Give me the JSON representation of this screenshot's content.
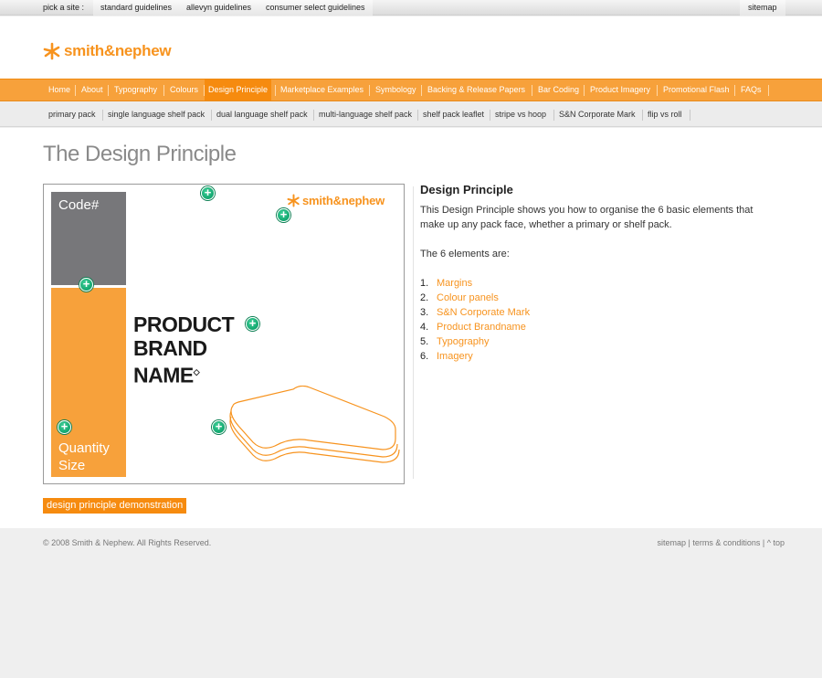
{
  "sitebar": {
    "pick_label": "pick a site :",
    "sites": [
      "standard guidelines",
      "allevyn guidelines",
      "consumer select guidelines"
    ],
    "sitemap": "sitemap"
  },
  "brand": {
    "name": "smith&nephew"
  },
  "main_nav": [
    "Home",
    "About",
    "Typography",
    "Colours",
    "Design Principle",
    "Marketplace Examples",
    "Symbology",
    "Backing & Release Papers",
    "Bar Coding",
    "Product Imagery",
    "Promotional Flash",
    "FAQs"
  ],
  "main_nav_active": "Design Principle",
  "sub_nav": [
    "primary pack",
    "single language shelf pack",
    "dual language shelf pack",
    "multi-language shelf pack",
    "shelf pack leaflet",
    "stripe vs hoop",
    "S&N Corporate Mark",
    "flip vs roll"
  ],
  "page": {
    "title": "The Design Principle"
  },
  "diagram": {
    "code_label": "Code#",
    "quantity_label": "Quantity Size",
    "brand_line_1": "PRODUCT",
    "brand_line_2": "BRAND",
    "brand_line_3": "NAME",
    "brand_mark": "◇",
    "logo_text": "smith&nephew"
  },
  "description": {
    "heading": "Design Principle",
    "intro": "This Design Principle shows you how to organise the 6 basic elements that make up any pack face, whether a primary or shelf pack.",
    "elements_intro": "The 6 elements are:",
    "elements": [
      {
        "num": "1.",
        "label": "Margins"
      },
      {
        "num": "2.",
        "label": "Colour panels"
      },
      {
        "num": "3.",
        "label": "S&N Corporate Mark"
      },
      {
        "num": "4.",
        "label": "Product Brandname"
      },
      {
        "num": "5.",
        "label": "Typography"
      },
      {
        "num": "6.",
        "label": "Imagery"
      }
    ]
  },
  "demo_button": "design principle demonstration",
  "footer": {
    "copyright": "© 2008 Smith & Nephew. All Rights Reserved.",
    "sitemap": "sitemap",
    "sep": " | ",
    "terms": "terms & conditions",
    "top": "^ top"
  },
  "colors": {
    "accent": "#f7931e",
    "nav": "#f7a13b",
    "panel_grey": "#77777a",
    "plus_green": "#00965e"
  }
}
